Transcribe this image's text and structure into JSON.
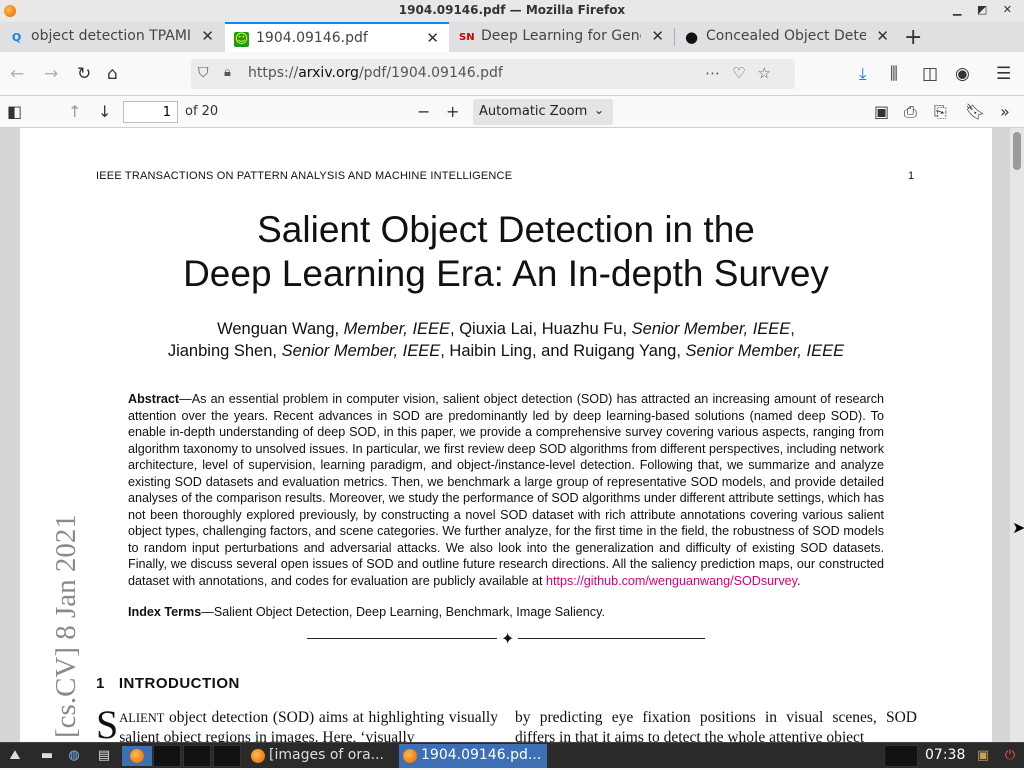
{
  "window": {
    "title": "1904.09146.pdf — Mozilla Firefox",
    "controls": "▁ ◩ ✕"
  },
  "tabs": [
    {
      "label": "object detection TPAMI ja",
      "icon": "search-icon",
      "glyph": "Q"
    },
    {
      "label": "1904.09146.pdf",
      "icon": "smiley-favicon",
      "glyph": "☺"
    },
    {
      "label": "Deep Learning for Gener",
      "icon": "sn-favicon",
      "glyph": "SN"
    },
    {
      "label": "Concealed Object Detecti",
      "icon": "github-favicon",
      "glyph": "●"
    }
  ],
  "new_tab_glyph": "+",
  "url": "https://arxiv.org/pdf/1904.09146.pdf",
  "url_display": {
    "prefix": "https://",
    "domain": "arxiv.org",
    "path": "/pdf/1904.09146.pdf"
  },
  "pdf_toolbar": {
    "page_value": "1",
    "page_count": "of 20",
    "zoom": "Automatic Zoom"
  },
  "pdf": {
    "running_header": "IEEE TRANSACTIONS ON PATTERN ANALYSIS AND MACHINE INTELLIGENCE",
    "page_number": "1",
    "title_line1": "Salient Object Detection in the",
    "title_line2": "Deep Learning Era: An In-depth Survey",
    "authors_line1": [
      "Wenguan Wang, ",
      "Member, IEEE",
      ", Qiuxia Lai, Huazhu Fu, ",
      "Senior Member, IEEE",
      ","
    ],
    "authors_line2": [
      "Jianbing Shen, ",
      "Senior Member, IEEE",
      ", Haibin Ling, and Ruigang Yang, ",
      "Senior Member, IEEE"
    ],
    "abstract_label": "Abstract",
    "abstract_text": "—As an essential problem in computer vision, salient object detection (SOD) has attracted an increasing amount of research attention over the years. Recent advances in SOD are predominantly led by deep learning-based solutions (named deep SOD). To enable in-depth understanding of deep SOD, in this paper, we provide a comprehensive survey covering various aspects, ranging from algorithm taxonomy to unsolved issues. In particular, we first review deep SOD algorithms from different perspectives, including network architecture, level of supervision, learning paradigm, and object-/instance-level detection. Following that, we summarize and analyze existing SOD datasets and evaluation metrics. Then, we benchmark a large group of representative SOD models, and provide detailed analyses of the comparison results. Moreover, we study the performance of SOD algorithms under different attribute settings, which has not been thoroughly explored previously, by constructing a novel SOD dataset with rich attribute annotations covering various salient object types, challenging factors, and scene categories. We further analyze, for the first time in the field, the robustness of SOD models to random input perturbations and adversarial attacks. We also look into the generalization and difficulty of existing SOD datasets. Finally, we discuss several open issues of SOD and outline future research directions. All the saliency prediction maps, our constructed dataset with annotations, and codes for evaluation are publicly available at ",
    "abstract_link": "https://github.com/wenguanwang/SODsurvey",
    "abstract_end": ".",
    "index_terms_label": "Index Terms",
    "index_terms_text": "—Salient Object Detection, Deep Learning, Benchmark, Image Saliency.",
    "divider_glyph": "✦",
    "section_number": "1",
    "section_title": "INTRODUCTION",
    "col1_dropcap": "S",
    "col1_smallcaps": "ALIENT",
    "col1_text": " object detection (SOD) aims at highlighting visually salient object regions in images. Here, ‘visually",
    "col2_text": "by predicting eye fixation positions in visual scenes, SOD differs in that it aims to detect the whole attentive object",
    "arxiv_stamp": "[cs.CV]  8 Jan 2021"
  },
  "taskbar": {
    "tasks": [
      {
        "label": "[images of ora..."
      },
      {
        "label": "1904.09146.pd..."
      }
    ],
    "clock": "07:38"
  },
  "colors": {
    "accent": "#0a84ff",
    "link": "#d6007a",
    "taskbar_active": "#3d6fb6"
  }
}
